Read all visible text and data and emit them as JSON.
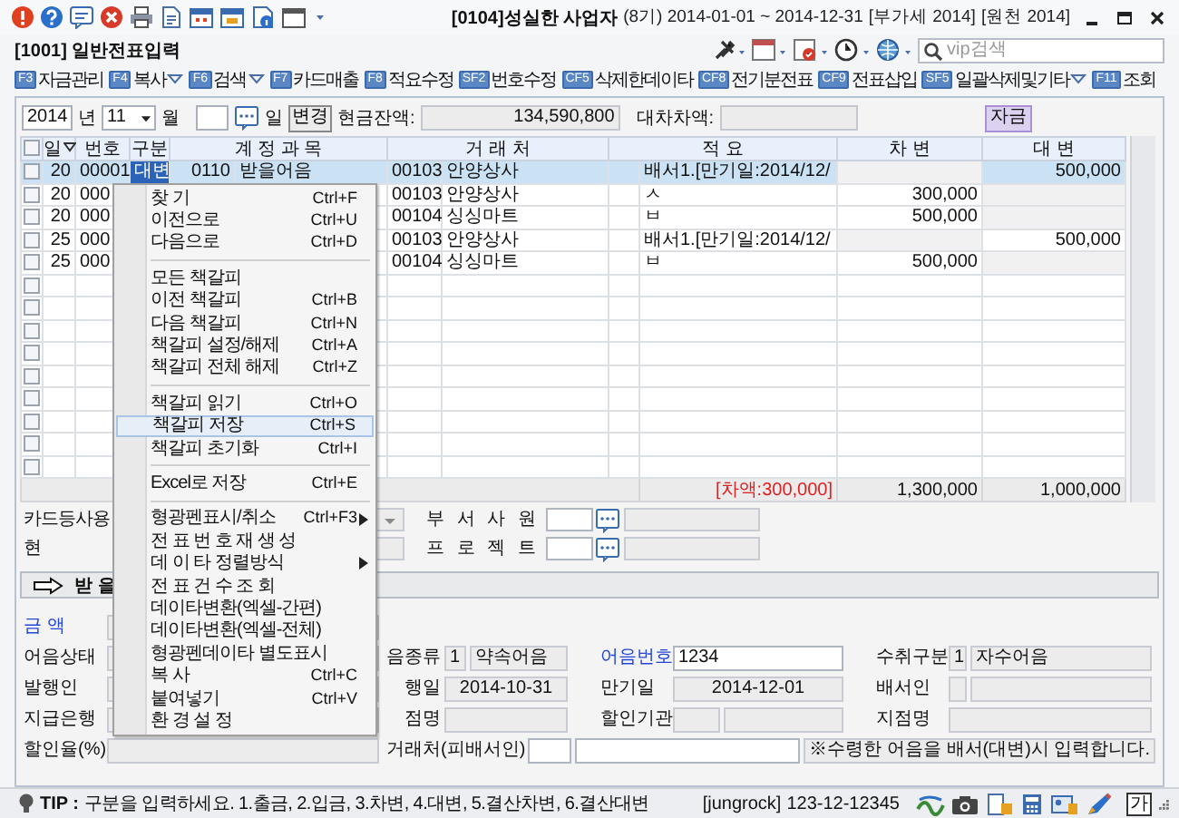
{
  "window": {
    "title": "[0104]성실한 사업자",
    "period": "(8기) 2014-01-01 ~ 2014-12-31",
    "vat": "[부가세 2014]",
    "withholding": "[원천 2014]"
  },
  "screen": {
    "title": "[1001] 일반전표입력",
    "search": {
      "placeholder": "vip검색"
    }
  },
  "toolbar": [
    {
      "key": "F3",
      "label": "자금관리",
      "dropdown": false
    },
    {
      "key": "F4",
      "label": "복사",
      "dropdown": true
    },
    {
      "key": "F6",
      "label": "검색",
      "dropdown": true
    },
    {
      "key": "F7",
      "label": "카드매출",
      "dropdown": false
    },
    {
      "key": "F8",
      "label": "적요수정",
      "dropdown": false
    },
    {
      "key": "SF2",
      "label": "번호수정",
      "dropdown": false
    },
    {
      "key": "CF5",
      "label": "삭제한데이타",
      "dropdown": false
    },
    {
      "key": "CF8",
      "label": "전기분전표",
      "dropdown": false
    },
    {
      "key": "CF9",
      "label": "전표삽입",
      "dropdown": false
    },
    {
      "key": "SF5",
      "label": "일괄삭제및기타",
      "dropdown": true
    },
    {
      "key": "F11",
      "label": "조회",
      "dropdown": false
    }
  ],
  "filter": {
    "year": "2014",
    "year_unit": "년",
    "month": "11",
    "month_unit": "월",
    "day_unit": "일",
    "change_button": "변경",
    "cash_label": "현금잔액:",
    "cash_balance": "134,590,800",
    "diff_label": "대차차액:",
    "badge": "자금"
  },
  "table": {
    "columns": [
      "일",
      "번호",
      "구분",
      "계 정 과 목",
      "거 래 처",
      "적 요",
      "차 변",
      "대 변"
    ],
    "header_checked": false,
    "rows": [
      {
        "checked": false,
        "selected": true,
        "day": "20",
        "number": "00001",
        "type": "대변",
        "account_code": "0110",
        "account": "받을어음",
        "customer_code": "00103",
        "customer": "안양상사",
        "memo": "배서1.[만기일:2014/12/",
        "credit": "500,000"
      },
      {
        "checked": false,
        "selected": false,
        "day": "20",
        "number": "000",
        "customer_code": "00103",
        "customer": "안양상사",
        "memo": "ㅅ",
        "debit": "300,000"
      },
      {
        "checked": false,
        "selected": false,
        "day": "20",
        "number": "000",
        "customer_code": "00104",
        "customer": "싱싱마트",
        "memo": "ㅂ",
        "debit": "500,000"
      },
      {
        "checked": false,
        "selected": false,
        "day": "25",
        "number": "000",
        "customer_code": "00103",
        "customer": "안양상사",
        "memo": "배서1.[만기일:2014/12/",
        "credit": "500,000"
      },
      {
        "checked": false,
        "selected": false,
        "day": "25",
        "number": "000",
        "customer_code": "00104",
        "customer": "싱싱마트",
        "memo": "ㅂ",
        "debit": "500,000"
      },
      {
        "checked": false,
        "selected": false
      },
      {
        "checked": false,
        "selected": false
      },
      {
        "checked": false,
        "selected": false
      },
      {
        "checked": false,
        "selected": false
      },
      {
        "checked": false,
        "selected": false
      },
      {
        "checked": false,
        "selected": false
      },
      {
        "checked": false,
        "selected": false
      },
      {
        "checked": false,
        "selected": false
      },
      {
        "checked": false,
        "selected": false
      }
    ],
    "totals": {
      "note": "[차액:300,000]",
      "debit": "1,300,000",
      "credit": "1,000,000"
    }
  },
  "context_menu": [
    {
      "kind": "item",
      "label": "찾 기",
      "shortcut": "Ctrl+F",
      "submenu": false,
      "selected": false
    },
    {
      "kind": "item",
      "label": "이전으로",
      "shortcut": "Ctrl+U",
      "submenu": false,
      "selected": false
    },
    {
      "kind": "item",
      "label": "다음으로",
      "shortcut": "Ctrl+D",
      "submenu": false,
      "selected": false
    },
    {
      "kind": "separator"
    },
    {
      "kind": "item",
      "label": "모든 책갈피",
      "submenu": false,
      "selected": false
    },
    {
      "kind": "item",
      "label": "이전 책갈피",
      "shortcut": "Ctrl+B",
      "submenu": false,
      "selected": false
    },
    {
      "kind": "item",
      "label": "다음 책갈피",
      "shortcut": "Ctrl+N",
      "submenu": false,
      "selected": false
    },
    {
      "kind": "item",
      "label": "책갈피 설정/해제",
      "shortcut": "Ctrl+A",
      "submenu": false,
      "selected": false
    },
    {
      "kind": "item",
      "label": "책갈피 전체 해제",
      "shortcut": "Ctrl+Z",
      "submenu": false,
      "selected": false
    },
    {
      "kind": "separator"
    },
    {
      "kind": "item",
      "label": "책갈피 읽기",
      "shortcut": "Ctrl+O",
      "submenu": false,
      "selected": false
    },
    {
      "kind": "item",
      "label": "책갈피 저장",
      "shortcut": "Ctrl+S",
      "submenu": false,
      "selected": true
    },
    {
      "kind": "item",
      "label": "책갈피 초기화",
      "shortcut": "Ctrl+I",
      "submenu": false,
      "selected": false
    },
    {
      "kind": "separator"
    },
    {
      "kind": "item",
      "label": "Excel로 저장",
      "shortcut": "Ctrl+E",
      "submenu": false,
      "selected": false
    },
    {
      "kind": "separator"
    },
    {
      "kind": "item",
      "label": "형광펜표시/취소",
      "shortcut": "Ctrl+F3",
      "submenu": true,
      "selected": false
    },
    {
      "kind": "item",
      "label": "전 표 번 호 재 생 성",
      "submenu": false,
      "selected": false
    },
    {
      "kind": "item",
      "label": "데 이 타 정렬방식",
      "submenu": true,
      "selected": false
    },
    {
      "kind": "item",
      "label": "전 표 건 수 조 회",
      "submenu": false,
      "selected": false
    },
    {
      "kind": "item",
      "label": "데이타변환(엑셀-간편)",
      "submenu": false,
      "selected": false
    },
    {
      "kind": "item",
      "label": "데이타변환(엑셀-전체)",
      "submenu": false,
      "selected": false
    },
    {
      "kind": "item",
      "label": "형광펜데이타 별도표시",
      "submenu": false,
      "selected": false
    },
    {
      "kind": "item",
      "label": "복 사",
      "shortcut": "Ctrl+C",
      "submenu": false,
      "selected": false
    },
    {
      "kind": "item",
      "label": "붙여넣기",
      "shortcut": "Ctrl+V",
      "submenu": false,
      "selected": false
    },
    {
      "kind": "item",
      "label": "환 경 설 정",
      "submenu": false,
      "selected": false
    }
  ],
  "top_form": [
    {
      "label": "카드등사용",
      "kind": "dropdown",
      "label_2": "부 서 사 원"
    },
    {
      "label": "현",
      "kind": "text",
      "label_2": "프 로 젝 트"
    }
  ],
  "section_title": "받 을",
  "bill_form": [
    {
      "pairs": [
        {
          "kind": "standard",
          "label": "금 액",
          "accent": true,
          "fields": [
            {
              "kind": "text",
              "editable": false
            }
          ]
        }
      ]
    },
    {
      "pairs": [
        {
          "kind": "standard",
          "label": "어음상태",
          "accent": false,
          "fields": [
            {
              "kind": "text",
              "editable": false
            }
          ]
        },
        {
          "kind": "standard",
          "label": "음종류",
          "accent": false,
          "fields": [
            {
              "kind": "code",
              "value": "1",
              "editable": false
            },
            {
              "kind": "text",
              "value": "약속어음",
              "editable": false
            }
          ]
        },
        {
          "kind": "standard",
          "label": "어음번호",
          "accent": true,
          "fields": [
            {
              "kind": "text",
              "value": "1234",
              "editable": true
            }
          ]
        },
        {
          "kind": "standard",
          "label": "수취구분",
          "accent": false,
          "fields": [
            {
              "kind": "code",
              "value": "1",
              "editable": false
            },
            {
              "kind": "text",
              "value": "자수어음",
              "editable": false
            }
          ]
        }
      ]
    },
    {
      "pairs": [
        {
          "kind": "standard",
          "label": "발행인",
          "accent": false,
          "fields": [
            {
              "kind": "text",
              "editable": false
            }
          ]
        },
        {
          "kind": "standard",
          "label": "행일",
          "accent": false,
          "fields": [
            {
              "kind": "date",
              "value": "2014-10-31",
              "editable": false
            }
          ]
        },
        {
          "kind": "standard",
          "label": "만기일",
          "accent": false,
          "fields": [
            {
              "kind": "date",
              "value": "2014-12-01",
              "editable": false
            }
          ]
        },
        {
          "kind": "standard",
          "label": "배서인",
          "accent": false,
          "fields": [
            {
              "kind": "code",
              "editable": false
            },
            {
              "kind": "text",
              "editable": false
            }
          ]
        }
      ]
    },
    {
      "pairs": [
        {
          "kind": "standard",
          "label": "지급은행",
          "accent": false,
          "fields": [
            {
              "kind": "text",
              "editable": false
            }
          ]
        },
        {
          "kind": "standard",
          "label": "점명",
          "accent": false,
          "fields": [
            {
              "kind": "text",
              "editable": false
            }
          ]
        },
        {
          "kind": "standard",
          "label": "할인기관",
          "accent": false,
          "fields": [
            {
              "kind": "code",
              "editable": false
            },
            {
              "kind": "text",
              "editable": false
            }
          ]
        },
        {
          "kind": "standard",
          "label": "지점명",
          "accent": false,
          "fields": [
            {
              "kind": "text",
              "editable": false
            }
          ]
        }
      ]
    },
    {
      "pairs": [
        {
          "kind": "standard",
          "label": "할인율(%)",
          "accent": false,
          "fields": [
            {
              "kind": "text",
              "editable": false
            }
          ]
        },
        {
          "kind": "wide",
          "label": "거래처(피배서인)",
          "accent": false,
          "fields": [
            {
              "kind": "code",
              "editable": true
            },
            {
              "kind": "text",
              "editable": true
            },
            {
              "kind": "note",
              "value": "※수령한 어음을 배서(대변)시 입력합니다.",
              "editable": false
            }
          ]
        }
      ]
    }
  ],
  "status_bar": {
    "tip_label": "TIP :",
    "tip": "구분을 입력하세요. 1.출금, 2.입금, 3.차변, 4.대변, 5.결산차변, 6.결산대변",
    "user": "[jungrock]",
    "business_no": "123-12-12345",
    "ime": "가"
  }
}
